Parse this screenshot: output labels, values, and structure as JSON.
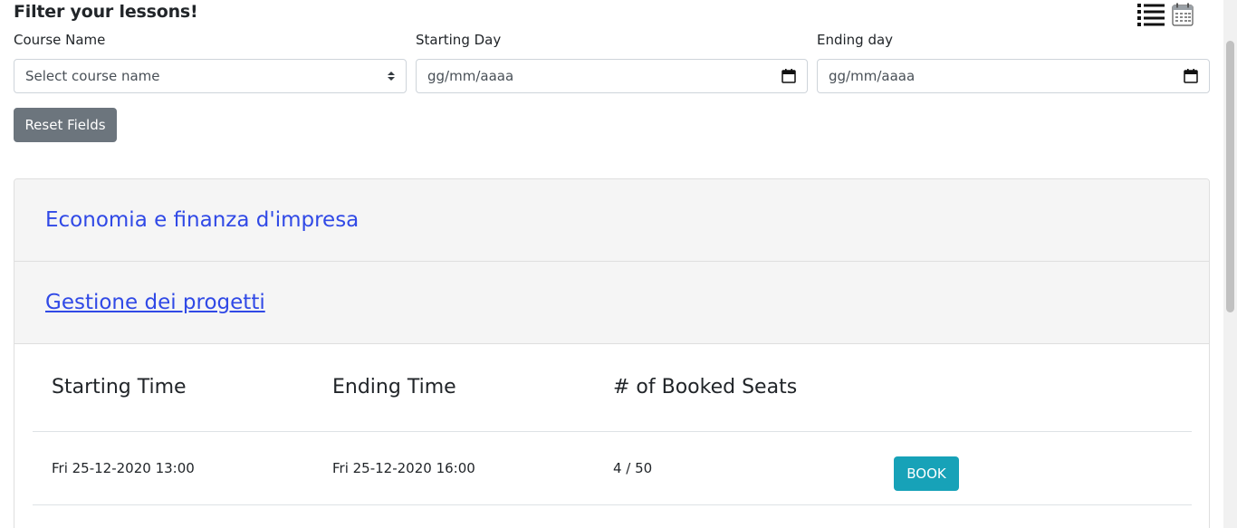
{
  "filter": {
    "title": "Filter your lessons!",
    "course_label": "Course Name",
    "course_placeholder": "Select course name",
    "start_label": "Starting Day",
    "start_placeholder": "gg/mm/aaaa",
    "end_label": "Ending day",
    "end_placeholder": "gg/mm/aaaa",
    "reset_label": "Reset Fields"
  },
  "view_icons": [
    "list-view-icon",
    "calendar-view-icon"
  ],
  "courses": [
    {
      "name": "Economia e finanza d'impresa",
      "expanded": false
    },
    {
      "name": "Gestione dei progetti",
      "expanded": true
    }
  ],
  "lessons_table": {
    "headers": [
      "Starting Time",
      "Ending Time",
      "# of Booked Seats"
    ],
    "rows": [
      {
        "start": "Fri 25-12-2020 13:00",
        "end": "Fri 25-12-2020 16:00",
        "seats": "4 / 50",
        "action": "BOOK"
      }
    ]
  },
  "colors": {
    "link": "#3049e6",
    "reset_button": "#6c757d",
    "book_button": "#17a2b8",
    "accordion_header": "#f5f5f5"
  }
}
